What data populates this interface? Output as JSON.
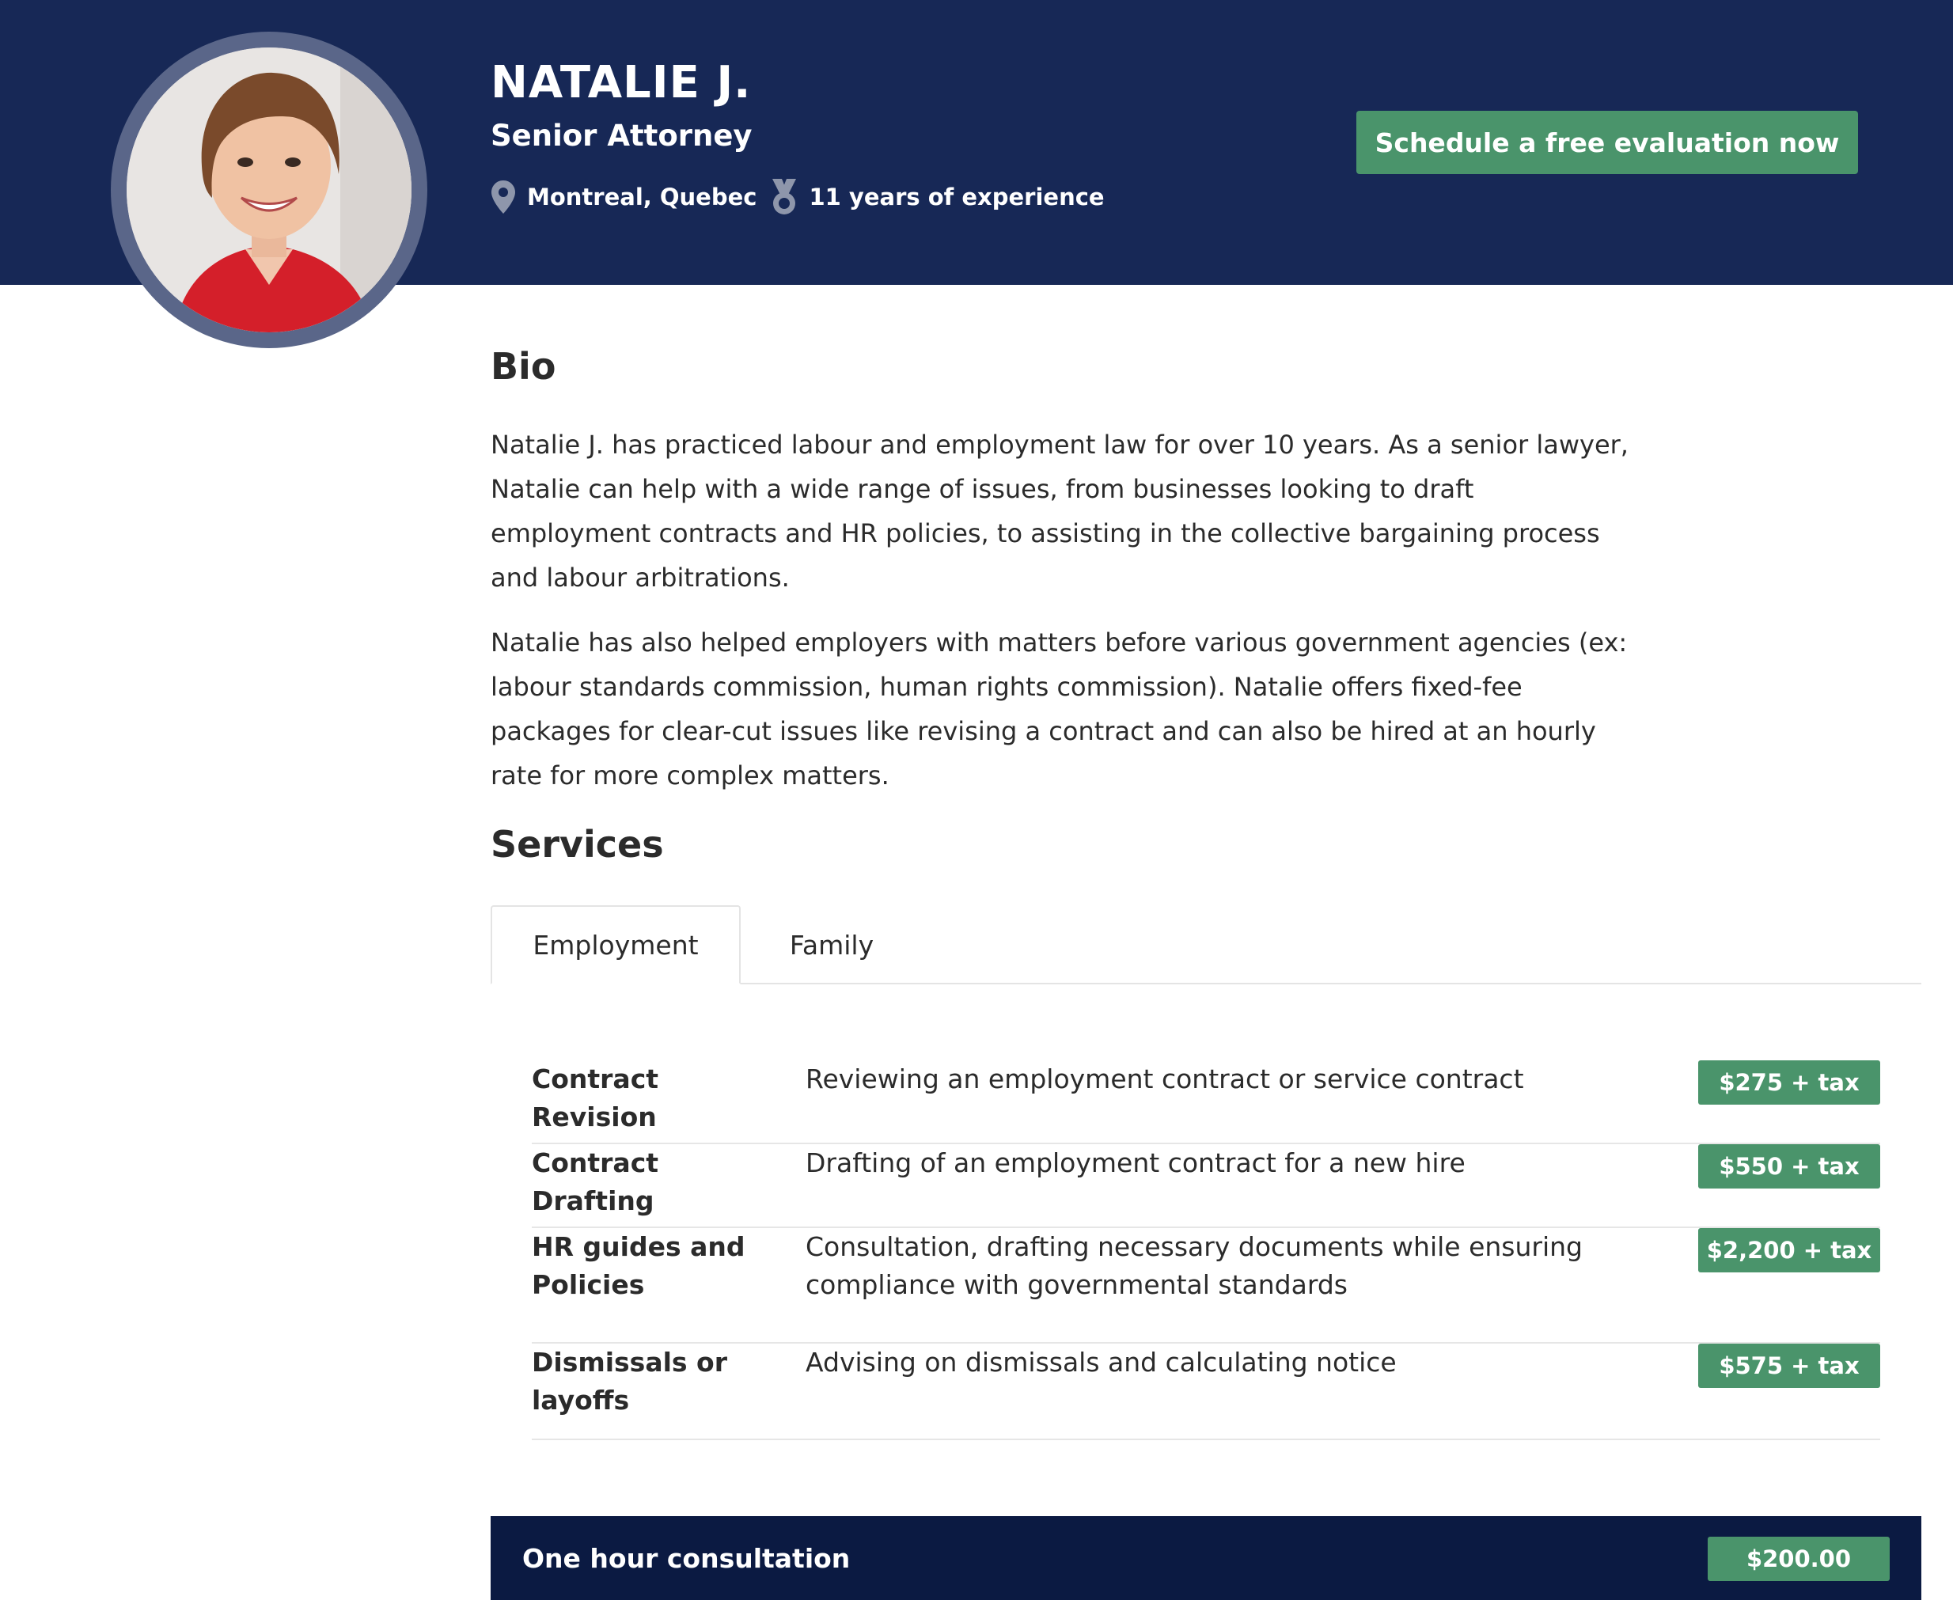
{
  "profile": {
    "name": "NATALIE J.",
    "title": "Senior Attorney",
    "location": "Montreal, Quebec",
    "experience": "11 years of experience"
  },
  "cta_label": "Schedule a free evaluation now",
  "bio": {
    "heading": "Bio",
    "paragraphs": [
      "Natalie J. has practiced labour and employment law for over 10 years. As a senior lawyer, Natalie can help with a wide range of issues, from businesses looking to draft employment contracts and HR policies, to assisting in the collective bargaining process and labour arbitrations.",
      "Natalie has also helped employers with matters before various government agencies (ex: labour standards commission, human rights commission). Natalie offers fixed-fee packages for clear-cut issues like revising a contract and can also be hired at an hourly rate for more complex matters."
    ]
  },
  "services": {
    "heading": "Services",
    "tabs": [
      {
        "label": "Employment",
        "active": true
      },
      {
        "label": "Family",
        "active": false
      }
    ],
    "items": [
      {
        "title": "Contract Revision",
        "description": "Reviewing an employment contract or service contract",
        "price": "$275 + tax"
      },
      {
        "title": "Contract Drafting",
        "description": "Drafting of an employment contract for a new hire",
        "price": "$550 + tax"
      },
      {
        "title": "HR guides and Policies",
        "description": "Consultation, drafting necessary documents while ensuring compliance with governmental standards",
        "price": "$2,200 + tax"
      },
      {
        "title": "Dismissals or layoffs",
        "description": "Advising on dismissals and calculating notice",
        "price": "$575 + tax"
      }
    ]
  },
  "consultation": {
    "label": "One hour consultation",
    "price": "$200.00"
  },
  "colors": {
    "hero_bg": "#172856",
    "accent_green": "#4a946b",
    "consult_bg": "#0b1a42"
  },
  "icons": {
    "location": "map-pin-icon",
    "experience": "medal-icon"
  }
}
